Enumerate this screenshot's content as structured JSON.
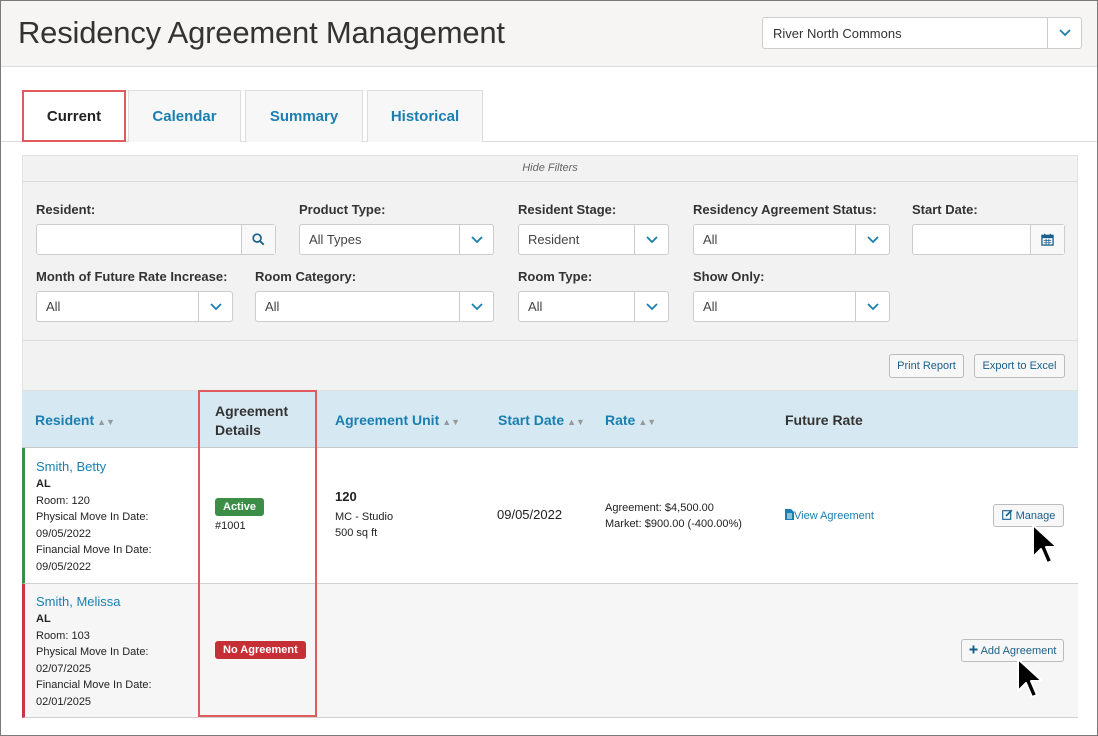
{
  "header": {
    "title": "Residency Agreement Management",
    "community": "River North Commons"
  },
  "tabs": [
    {
      "label": "Current",
      "active": true
    },
    {
      "label": "Calendar",
      "active": false
    },
    {
      "label": "Summary",
      "active": false
    },
    {
      "label": "Historical",
      "active": false
    }
  ],
  "filters": {
    "toggle_label": "Hide Filters",
    "resident": {
      "label": "Resident:",
      "value": ""
    },
    "product_type": {
      "label": "Product Type:",
      "value": "All Types"
    },
    "resident_stage": {
      "label": "Resident Stage:",
      "value": "Resident"
    },
    "agreement_status": {
      "label": "Residency Agreement Status:",
      "value": "All"
    },
    "start_date": {
      "label": "Start Date:",
      "value": ""
    },
    "future_rate_month": {
      "label": "Month of Future Rate Increase:",
      "value": "All"
    },
    "room_category": {
      "label": "Room Category:",
      "value": "All"
    },
    "room_type": {
      "label": "Room Type:",
      "value": "All"
    },
    "show_only": {
      "label": "Show Only:",
      "value": "All"
    }
  },
  "actions": {
    "print_report": "Print Report",
    "export_excel": "Export to Excel"
  },
  "table": {
    "headers": {
      "resident": "Resident",
      "agreement_details_1": "Agreement",
      "agreement_details_2": "Details",
      "agreement_unit": "Agreement Unit",
      "start_date": "Start Date",
      "rate": "Rate",
      "future_rate": "Future Rate"
    },
    "rows": [
      {
        "name": "Smith, Betty",
        "level": "AL",
        "room": "Room: 120",
        "physical_label": "Physical Move In Date:",
        "physical_date": "09/05/2022",
        "financial_label": "Financial Move In Date:",
        "financial_date": "09/05/2022",
        "status": "Active",
        "agreement_no": "#1001",
        "unit_no": "120",
        "unit_type": "MC - Studio",
        "unit_size": "500 sq ft",
        "start_date": "09/05/2022",
        "rate_agreement": "Agreement: $4,500.00",
        "rate_market": "Market: $900.00 (-400.00%)",
        "future_rate_link": "View Agreement",
        "action": "Manage"
      },
      {
        "name": "Smith, Melissa",
        "level": "AL",
        "room": "Room: 103",
        "physical_label": "Physical Move In Date:",
        "physical_date": "02/07/2025",
        "financial_label": "Financial Move In Date:",
        "financial_date": "02/01/2025",
        "status": "No Agreement",
        "action": "Add Agreement"
      }
    ]
  },
  "colors": {
    "accent_blue": "#1a7fb0",
    "active_green": "#3c8e46",
    "no_agreement_red": "#c62f36",
    "highlight_red": "#e05a5f",
    "header_blue": "#d6e9f3"
  },
  "icons": [
    "chevron-down-icon",
    "search-icon",
    "calendar-icon",
    "sort-icon",
    "document-icon",
    "edit-icon",
    "plus-icon",
    "mouse-pointer-icon"
  ]
}
